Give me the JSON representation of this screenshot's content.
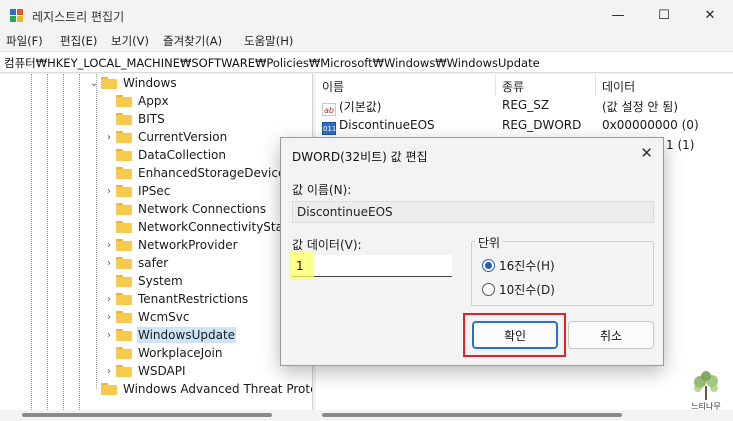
{
  "window": {
    "title": "레지스트리 편집기",
    "controls": {
      "minimize": "—",
      "maximize": "☐",
      "close": "✕"
    }
  },
  "menu": [
    "파일(F)",
    "편집(E)",
    "보기(V)",
    "즐겨찾기(A)",
    "도움말(H)"
  ],
  "address": "컴퓨터₩HKEY_LOCAL_MACHINE₩SOFTWARE₩Policies₩Microsoft₩Windows₩WindowsUpdate",
  "tree": {
    "parent": "Windows",
    "children": [
      "Appx",
      "BITS",
      "CurrentVersion",
      "DataCollection",
      "EnhancedStorageDevices",
      "IPSec",
      "Network Connections",
      "NetworkConnectivityStatus",
      "NetworkProvider",
      "safer",
      "System",
      "TenantRestrictions",
      "WcmSvc",
      "WindowsUpdate",
      "WorkplaceJoin",
      "WSDAPI"
    ],
    "sibling": "Windows Advanced Threat Prote",
    "selected": "WindowsUpdate"
  },
  "list": {
    "columns": [
      "이름",
      "종류",
      "데이터"
    ],
    "rows": [
      {
        "icon": "string-value-icon",
        "icon_text": "ab",
        "name": "(기본값)",
        "type": "REG_SZ",
        "data": "(값 설정 안 됨)"
      },
      {
        "icon": "dword-value-icon",
        "icon_text": "011",
        "name": "DiscontinueEOS",
        "type": "REG_DWORD",
        "data": "0x00000000 (0)"
      }
    ],
    "partial_data": "1 (1)"
  },
  "dialog": {
    "title": "DWORD(32비트) 값 편집",
    "close": "✕",
    "name_label": "값 이름(N):",
    "name_value": "DiscontinueEOS",
    "data_label": "값 데이터(V):",
    "data_value": "1",
    "base_label": "단위",
    "base_options": [
      {
        "label": "16진수(H)",
        "checked": true
      },
      {
        "label": "10진수(D)",
        "checked": false
      }
    ],
    "ok_label": "확인",
    "cancel_label": "취소"
  },
  "watermark": "느티나무",
  "colors": {
    "selection": "#cce4f7",
    "highlight": "#ffff66",
    "red_box": "#e0202a",
    "accent": "#1f5fbf",
    "folder": "#f6c94f"
  }
}
